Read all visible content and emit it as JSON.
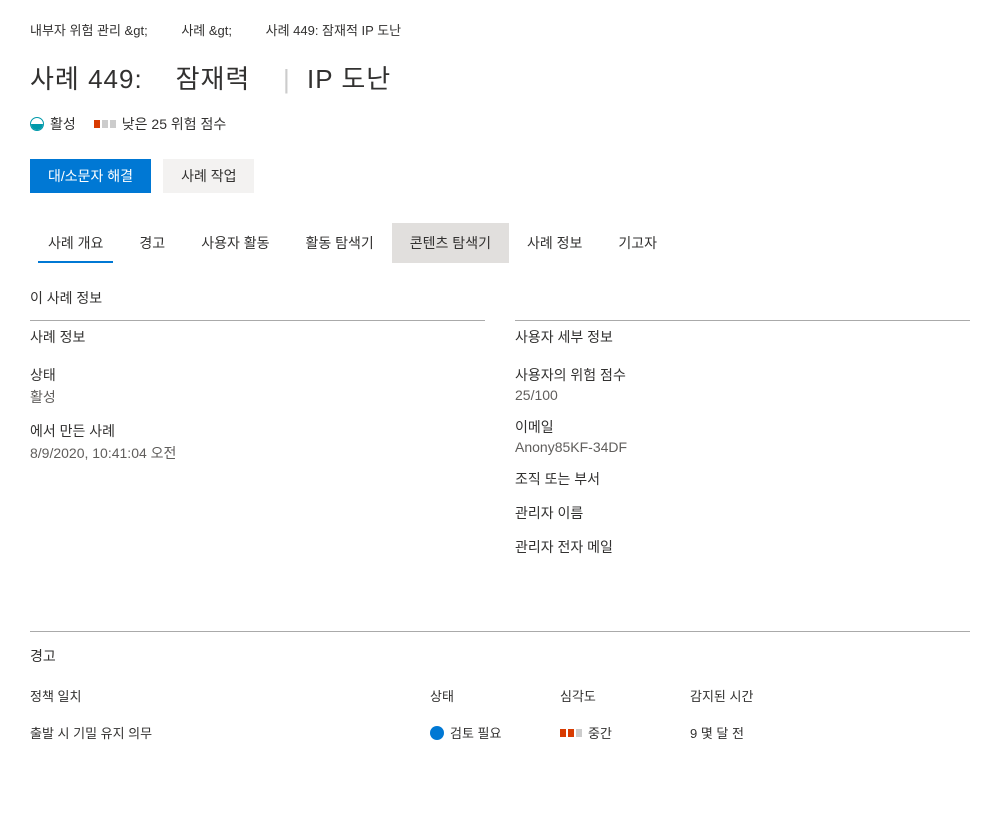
{
  "breadcrumb": {
    "item1": "내부자 위험 관리 &gt;",
    "item2": "사례 &gt;",
    "item3": "사례 449: 잠재적 IP 도난"
  },
  "title": {
    "part1": "사례 449:",
    "part2": "잠재력",
    "part3": "IP 도난"
  },
  "status": {
    "label": "활성",
    "riskText": "낮은 25 위험 점수"
  },
  "buttons": {
    "resolve": "대/소문자 해결",
    "actions": "사례 작업"
  },
  "tabs": [
    {
      "label": "사례 개요"
    },
    {
      "label": "경고"
    },
    {
      "label": "사용자 활동"
    },
    {
      "label": "활동 탐색기"
    },
    {
      "label": "콘텐츠 탐색기"
    },
    {
      "label": "사례 정보"
    },
    {
      "label": "기고자"
    }
  ],
  "aboutSection": {
    "header": "이 사례 정보"
  },
  "caseInfo": {
    "title": "사례 정보",
    "statusLabel": "상태",
    "statusValue": "활성",
    "createdLabel": "에서 만든 사례",
    "createdValue": "8/9/2020, 10:41:04 오전"
  },
  "userDetails": {
    "title": "사용자 세부 정보",
    "riskScoreLabel": "사용자의 위험 점수",
    "riskScoreValue": "25/100",
    "emailLabel": "이메일",
    "emailValue": "Anony85KF-34DF",
    "orgLabel": "조직 또는 부서",
    "managerNameLabel": "관리자 이름",
    "managerEmailLabel": "관리자 전자 메일"
  },
  "alerts": {
    "title": "경고",
    "headers": {
      "policy": "정책 일치",
      "status": "상태",
      "severity": "심각도",
      "detected": "감지된 시간"
    },
    "row": {
      "policy": "출발 시 기밀 유지 의무",
      "status": "검토 필요",
      "severity": "중간",
      "detected": "9 몇 달 전"
    }
  }
}
